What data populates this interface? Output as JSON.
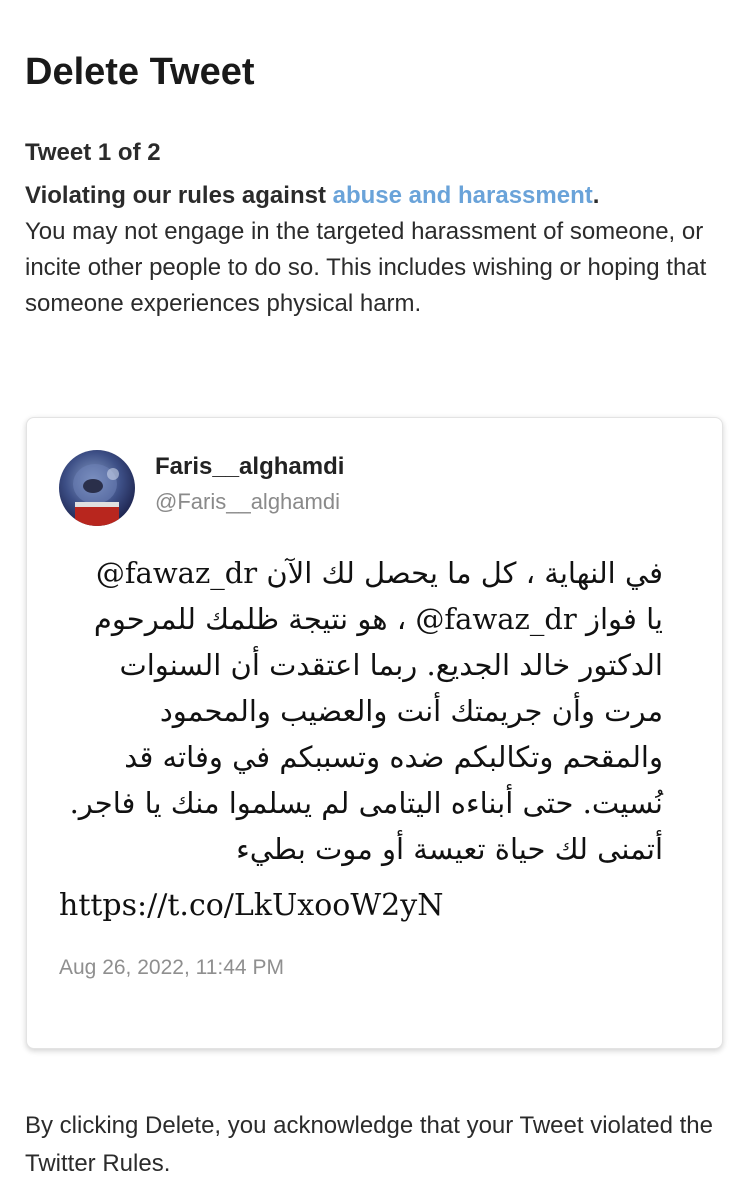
{
  "page": {
    "title": "Delete Tweet",
    "counter": "Tweet 1 of 2"
  },
  "violation": {
    "heading_prefix": "Violating our rules against ",
    "link_text": "abuse and harassment",
    "heading_suffix": ".",
    "body": "You may not engage in the targeted harassment of someone, or incite other people to do so. This includes wishing or hoping that someone experiences physical harm."
  },
  "tweet": {
    "display_name": "Faris__alghamdi",
    "handle": "@Faris__alghamdi",
    "text": "@fawaz_dr في النهاية ، كل ما يحصل لك الآن هو نتيجة ظلمك للمرحوم ، @fawaz_dr يا فواز الدكتور خالد الجديع. ربما اعتقدت أن السنوات مرت وأن جريمتك أنت والعضيب والمحمود والمقحم وتكالبكم ضده وتسببكم في وفاته قد نُسيت. حتى أبناءه اليتامى لم يسلموا منك يا فاجر. أتمنى لك حياة تعيسة أو موت بطيء",
    "link": "https://t.co/LkUxooW2yN",
    "timestamp": "Aug 26, 2022, 11:44 PM"
  },
  "footer": {
    "text": "By clicking Delete, you acknowledge that your Tweet violated the Twitter Rules."
  },
  "colors": {
    "link": "#6aa3d9",
    "text": "#2b2b2b",
    "muted": "#8f8f8f"
  },
  "icons": {
    "avatar": "profile-photo"
  }
}
